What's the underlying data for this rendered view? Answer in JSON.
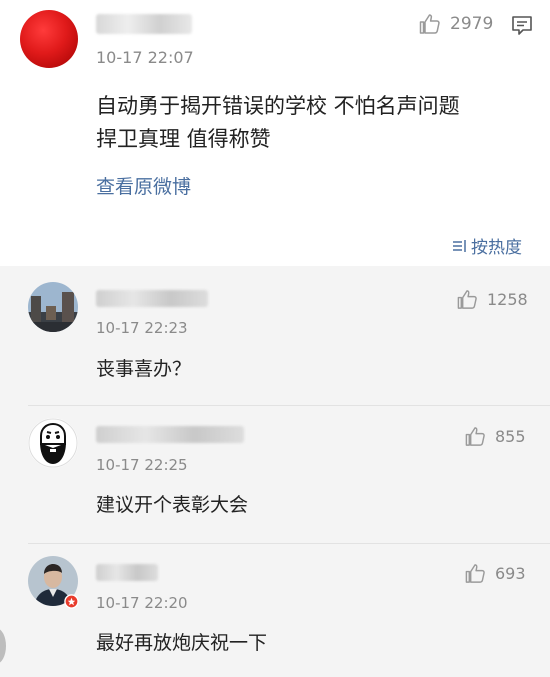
{
  "main_post": {
    "avatar_icon": "red-circle-avatar",
    "time": "10-17 22:07",
    "like_count": "2979",
    "text_line1": "自动勇于揭开错误的学校 不怕名声问题",
    "text_line2": "捍卫真理 值得称赞",
    "view_original": "查看原微博"
  },
  "sort": {
    "label": "按热度",
    "icon": "sort-lines-icon"
  },
  "comments": [
    {
      "time": "10-17 22:23",
      "like_count": "1258",
      "text": "丧事喜办？",
      "avatar": "street-photo-avatar"
    },
    {
      "time": "10-17 22:25",
      "like_count": "855",
      "text": "建议开个表彰大会",
      "avatar": "bearded-face-avatar"
    },
    {
      "time": "10-17 22:20",
      "like_count": "693",
      "text": "最好再放炮庆祝一下",
      "avatar": "person-photo-avatar"
    }
  ],
  "colors": {
    "accent_link": "#4a6fa0",
    "muted_text": "#8a8a8a",
    "comments_bg": "#f4f4f4"
  }
}
